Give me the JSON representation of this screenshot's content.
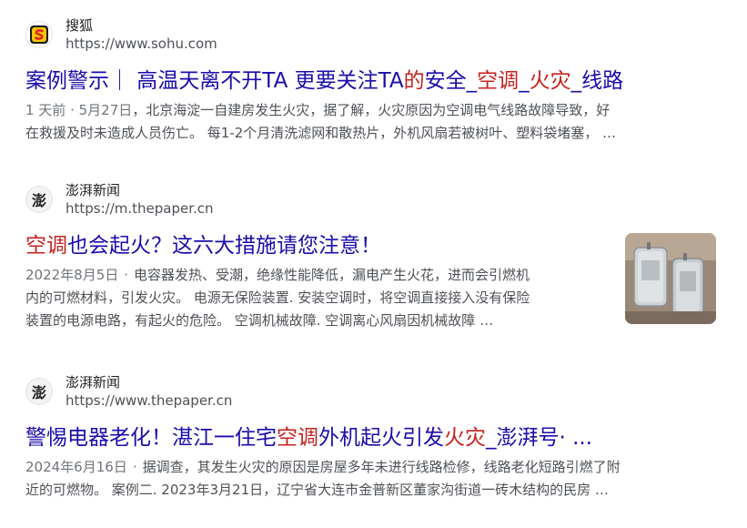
{
  "results": [
    {
      "site_name": "搜狐",
      "url": "https://www.sohu.com",
      "favicon": "sohu-logo-icon",
      "title_parts": [
        {
          "text": "案例警示｜ 高温天离不开TA 更要关注TA",
          "hl": false
        },
        {
          "text": "的",
          "hl": true
        },
        {
          "text": "安全_",
          "hl": false
        },
        {
          "text": "空调",
          "hl": true
        },
        {
          "text": "_",
          "hl": false
        },
        {
          "text": "火灾",
          "hl": true
        },
        {
          "text": "_线路",
          "hl": false
        }
      ],
      "date": "1 天前 · 5月27日",
      "snippet_line1": "，北京海淀一自建房发生火灾，据了解，火灾原因为空调电气线路故障导致，好",
      "snippet_line2": "在救援及时未造成人员伤亡。 每1-2个月清洗滤网和散热片，外机风扇若被树叶、塑料袋堵塞， …"
    },
    {
      "site_name": "澎湃新闻",
      "url": "https://m.thepaper.cn",
      "favicon": "thepaper-logo-icon",
      "title_parts": [
        {
          "text": "空调",
          "hl": true
        },
        {
          "text": "也会起火？这六大措施请您注意！",
          "hl": false
        }
      ],
      "date": "2022年8月5日",
      "snippet_line1": "电容器发热、受潮，绝缘性能降低，漏电产生火花，进而会引燃机",
      "snippet_line2": "内的可燃材料，引发火灾。 电源无保险装置. 安装空调时，将空调直接接入没有保险",
      "snippet_line3": "装置的电源电路，有起火的危险。 空调机械故障. 空调离心风扇因机械故障 …",
      "thumbnail": "capacitor-photo"
    },
    {
      "site_name": "澎湃新闻",
      "url": "https://www.thepaper.cn",
      "favicon": "thepaper-logo-icon",
      "title_parts": [
        {
          "text": "警惕电器老化！湛江一住宅",
          "hl": false
        },
        {
          "text": "空调",
          "hl": true
        },
        {
          "text": "外机起火引发",
          "hl": false
        },
        {
          "text": "火灾",
          "hl": true
        },
        {
          "text": "_澎湃号· ...",
          "hl": false
        }
      ],
      "date": "2024年6月16日",
      "snippet_line1": "据调查，其发生火灾的原因是房屋多年未进行线路检修，线路老化短路引燃了附",
      "snippet_line2": "近的可燃物。 案例二. 2023年3月21日，辽宁省大连市金普新区董家沟街道一砖木结构的民房 …"
    }
  ]
}
